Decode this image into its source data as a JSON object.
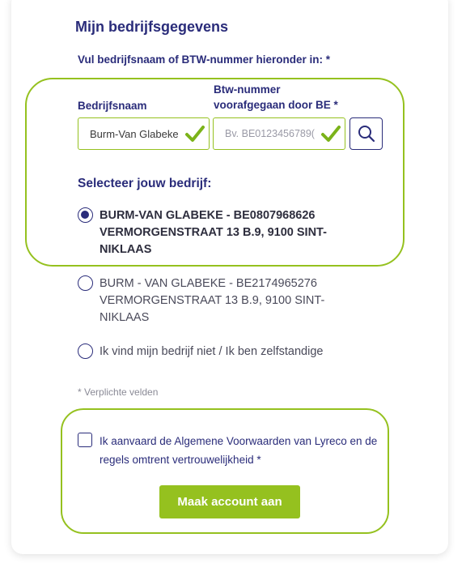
{
  "form": {
    "title": "Mijn bedrijfsgegevens",
    "instruction": "Vul bedrijfsnaam of BTW-nummer hieronder in: *",
    "company_label": "Bedrijfsnaam",
    "company_value": "Burm-Van Glabeke",
    "vat_label": "Btw-nummer voorafgegaan door BE *",
    "vat_placeholder": "Bv. BE0123456789(",
    "search_icon": "search-icon",
    "check_icon": "checkmark-icon",
    "select_title": "Selecteer jouw bedrijf:",
    "options": [
      {
        "text": "BURM-VAN GLABEKE - BE0807968626 VERMORGENSTRAAT 13 B.9, 9100 SINT-NIKLAAS",
        "selected": true
      },
      {
        "text": "BURM - VAN GLABEKE - BE2174965276 VERMORGENSTRAAT 13 B.9, 9100 SINT-NIKLAAS",
        "selected": false
      },
      {
        "text": "Ik vind mijn bedrijf niet / Ik ben zelfstandige",
        "selected": false
      }
    ],
    "required_note": "* Verplichte velden",
    "terms": {
      "prefix": "Ik aanvaard de ",
      "link1": "Algemene Voorwaarden",
      "middle": " van Lyreco en de ",
      "link2": "regels omtrent vertrouwelijkheid",
      "suffix": " *",
      "checked": false
    },
    "submit_label": "Maak account aan"
  },
  "colors": {
    "primary": "#2a2c7a",
    "accent_green": "#95c11f"
  }
}
